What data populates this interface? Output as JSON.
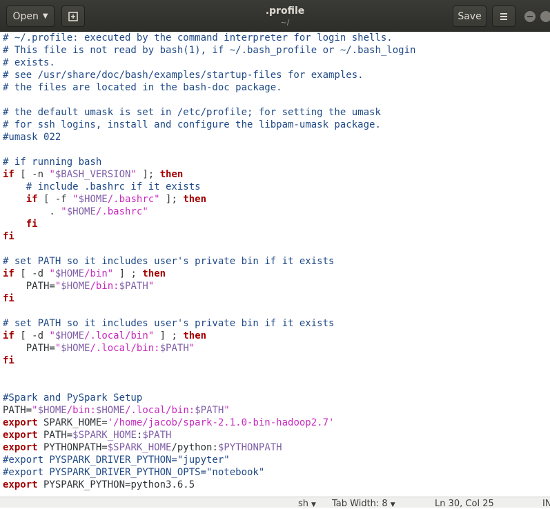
{
  "header": {
    "open_label": "Open",
    "title": ".profile",
    "subtitle": "~/",
    "save_label": "Save"
  },
  "status": {
    "language": "sh",
    "tab_width": "Tab Width: 8",
    "position": "Ln 30, Col 25",
    "mode": "INS"
  },
  "lines": [
    "# ~/.profile: executed by the command interpreter for login shells.",
    "# This file is not read by bash(1), if ~/.bash_profile or ~/.bash_login",
    "# exists.",
    "# see /usr/share/doc/bash/examples/startup-files for examples.",
    "# the files are located in the bash-doc package.",
    "",
    "# the default umask is set in /etc/profile; for setting the umask",
    "# for ssh logins, install and configure the libpam-umask package.",
    "#umask 022",
    "",
    "# if running bash",
    "if [ -n \"$BASH_VERSION\" ]; then",
    "    # include .bashrc if it exists",
    "    if [ -f \"$HOME/.bashrc\" ]; then",
    "        . \"$HOME/.bashrc\"",
    "    fi",
    "fi",
    "",
    "# set PATH so it includes user's private bin if it exists",
    "if [ -d \"$HOME/bin\" ] ; then",
    "    PATH=\"$HOME/bin:$PATH\"",
    "fi",
    "",
    "# set PATH so it includes user's private bin if it exists",
    "if [ -d \"$HOME/.local/bin\" ] ; then",
    "    PATH=\"$HOME/.local/bin:$PATH\"",
    "fi",
    "",
    "",
    "#Spark and PySpark Setup",
    "PATH=\"$HOME/bin:$HOME/.local/bin:$PATH\"",
    "export SPARK_HOME='/home/jacob/spark-2.1.0-bin-hadoop2.7'",
    "export PATH=$SPARK_HOME:$PATH",
    "export PYTHONPATH=$SPARK_HOME/python:$PYTHONPATH",
    "#export PYSPARK_DRIVER_PYTHON=\"jupyter\"",
    "#export PYSPARK_DRIVER_PYTHON_OPTS=\"notebook\"",
    "export PYSPARK_PYTHON=python3.6.5"
  ]
}
